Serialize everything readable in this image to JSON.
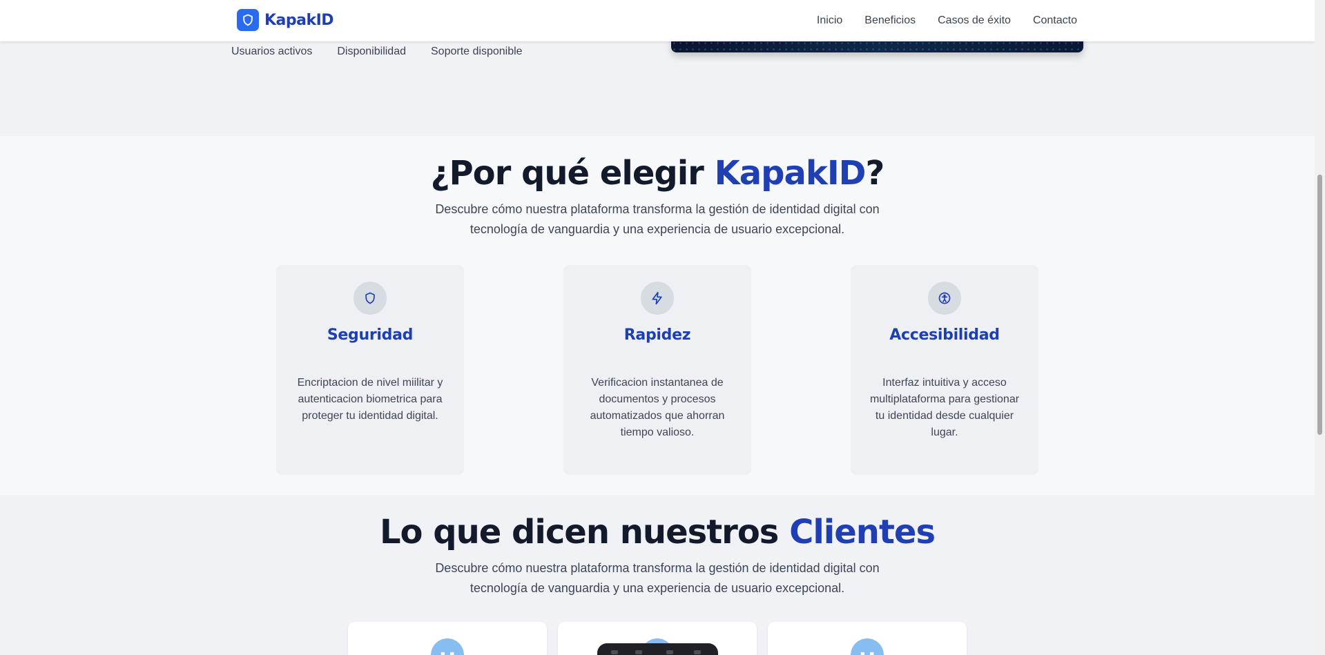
{
  "brand": {
    "name": "KapakID",
    "accent_color": "#2a6af0",
    "logo_icon": "shield-icon"
  },
  "nav": {
    "items": [
      "Inicio",
      "Beneficios",
      "Casos de éxito",
      "Contacto"
    ]
  },
  "hero": {
    "stats": [
      "Usuarios activos",
      "Disponibilidad",
      "Soporte disponible"
    ]
  },
  "why": {
    "title_prefix": "¿Por qué elegir ",
    "title_accent": "KapakID",
    "title_suffix": "?",
    "subtitle_line1": "Descubre cómo nuestra plataforma transforma la gestión de identidad digital con",
    "subtitle_line2": "tecnología de vanguardia y una experiencia de usuario excepcional.",
    "features": [
      {
        "icon": "shield-icon",
        "title": "Seguridad",
        "description": "Encriptacion de nivel miilitar y autenticacion biometrica para proteger tu identidad digital."
      },
      {
        "icon": "lightning-icon",
        "title": "Rapidez",
        "description": "Verificacion instantanea de documentos y procesos automatizados que ahorran tiempo valioso."
      },
      {
        "icon": "accessibility-icon",
        "title": "Accesibilidad",
        "description": "Interfaz intuitiva y acceso multiplataforma para gestionar tu identidad desde cualquier lugar."
      }
    ]
  },
  "testimonials": {
    "title_prefix": "Lo que dicen nuestros ",
    "title_accent": "Clientes",
    "subtitle_line1": "Descubre cómo nuestra plataforma transforma la gestión de identidad digital con",
    "subtitle_line2": "tecnología de vanguardia y una experiencia de usuario excepcional."
  },
  "colors": {
    "accent_text": "#1d3fb3",
    "heading": "#131a2b",
    "card_bg": "#eef0f3"
  }
}
